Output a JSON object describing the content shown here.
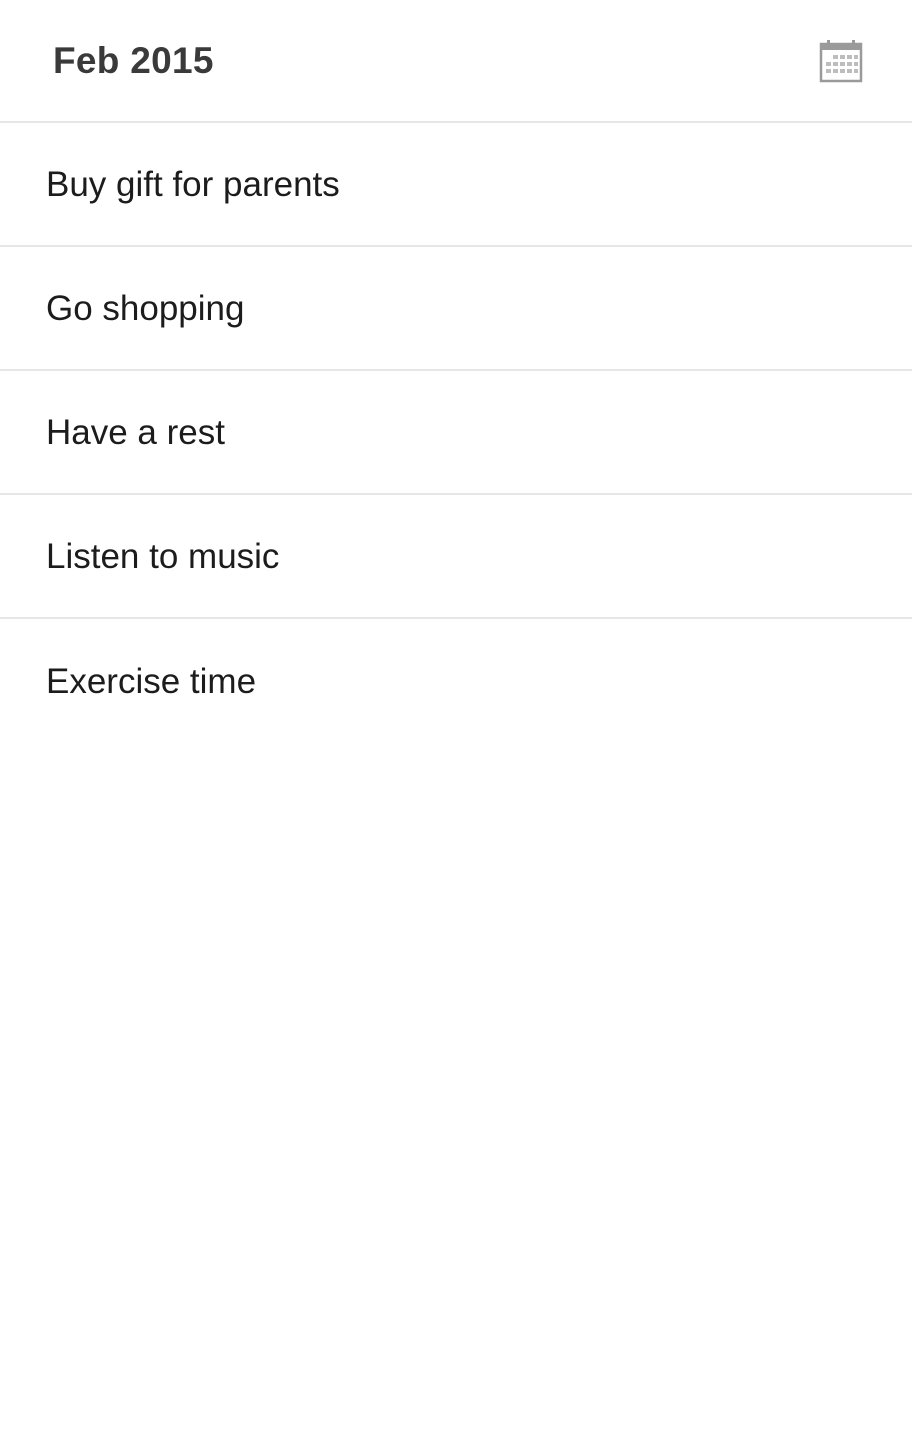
{
  "header": {
    "title": "Feb 2015",
    "calendar_icon": "calendar-icon"
  },
  "tasks": [
    {
      "label": "Buy gift for parents"
    },
    {
      "label": "Go shopping"
    },
    {
      "label": "Have a rest"
    },
    {
      "label": "Listen to music"
    },
    {
      "label": "Exercise time"
    }
  ],
  "colors": {
    "background": "#ffffff",
    "title": "#3a3a3a",
    "text": "#1c1c1c",
    "divider": "#e6e6e6",
    "icon": "#9a9a9a"
  }
}
